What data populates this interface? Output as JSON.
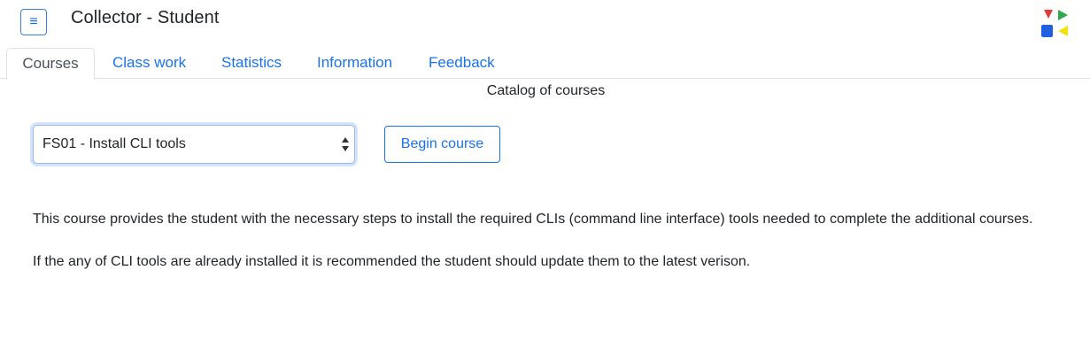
{
  "header": {
    "title": "Collector - Student",
    "menu_icon": "≡",
    "logo_colors": [
      "#e53935",
      "#2eaa4a",
      "#1f5fe0",
      "#f2e30f"
    ]
  },
  "tabs": [
    {
      "label": "Courses",
      "active": true
    },
    {
      "label": "Class work",
      "active": false
    },
    {
      "label": "Statistics",
      "active": false
    },
    {
      "label": "Information",
      "active": false
    },
    {
      "label": "Feedback",
      "active": false
    }
  ],
  "catalog": {
    "title": "Catalog of courses",
    "selected_course": "FS01 - Install CLI tools",
    "begin_button": "Begin course"
  },
  "description": {
    "paragraphs": [
      "This course provides the student with the necessary steps to install the required CLIs (command line interface) tools needed to complete the additional courses.",
      "If the any of CLI tools are already installed it is recommended the student should update them to the latest verison."
    ]
  },
  "colors": {
    "link": "#1a73e8",
    "text": "#212529"
  }
}
